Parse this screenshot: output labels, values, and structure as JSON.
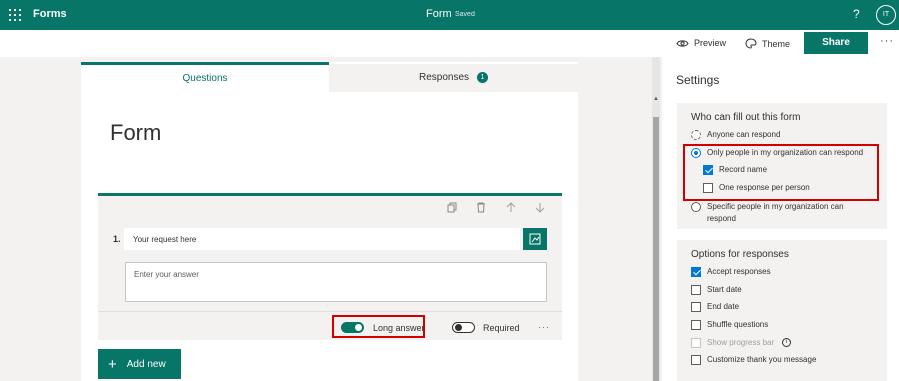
{
  "topbar": {
    "app_name": "Forms",
    "doc_title": "Form",
    "doc_status": "Saved",
    "help": "?",
    "avatar_initials": "IT"
  },
  "cmdbar": {
    "preview": "Preview",
    "theme": "Theme",
    "share": "Share",
    "more": "···"
  },
  "tabs": {
    "questions": "Questions",
    "responses": "Responses",
    "responses_count": "1"
  },
  "form": {
    "title": "Form",
    "question": {
      "number": "1.",
      "text": "Your request here",
      "answer_placeholder": "Enter your answer",
      "long_answer_label": "Long answer",
      "long_answer_on": true,
      "required_label": "Required",
      "required_on": false,
      "more": "···"
    },
    "add_new": "Add new"
  },
  "settings": {
    "title": "Settings",
    "who": {
      "title": "Who can fill out this form",
      "anyone": "Anyone can respond",
      "only_org": "Only people in my organization can respond",
      "record_name": "Record name",
      "one_response": "One response per person",
      "specific": "Specific people in my organization can respond"
    },
    "options": {
      "title": "Options for responses",
      "accept": "Accept responses",
      "start_date": "Start date",
      "end_date": "End date",
      "shuffle": "Shuffle questions",
      "progress_bar": "Show progress bar",
      "thank_you": "Customize thank you message"
    }
  },
  "colors": {
    "brand": "#077568",
    "accent": "#0078d4",
    "highlight": "#d40000"
  }
}
